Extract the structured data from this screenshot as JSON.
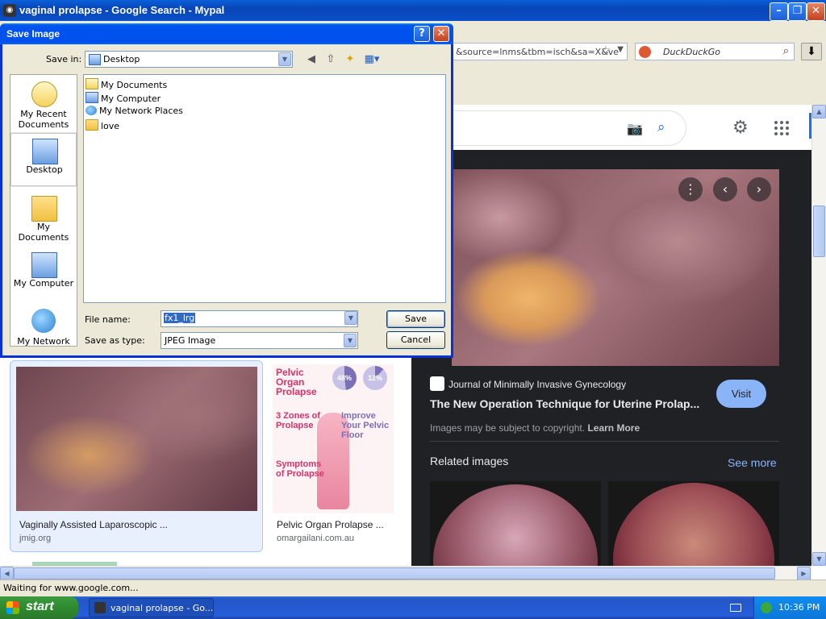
{
  "browser": {
    "title": "vaginal prolapse - Google Search - Mypal",
    "url": "&source=lnms&tbm=isch&sa=X&ve",
    "search_engine": "DuckDuckGo",
    "status": "Waiting for www.google.com..."
  },
  "dialog": {
    "title": "Save Image",
    "help": "?",
    "close": "✕",
    "save_in_label": "Save in:",
    "save_in_value": "Desktop",
    "places": [
      "My Recent Documents",
      "Desktop",
      "My Documents",
      "My Computer",
      "My Network"
    ],
    "files": [
      "My Documents",
      "My Computer",
      "My Network Places",
      "love"
    ],
    "file_name_label": "File name:",
    "file_name_value": "fx1_lrg",
    "save_as_type_label": "Save as type:",
    "save_as_type_value": "JPEG Image",
    "save_button": "Save",
    "cancel_button": "Cancel"
  },
  "preview": {
    "source": "Journal of Minimally Invasive Gynecology",
    "title": "The New Operation Technique for Uterine Prolap...",
    "visit": "Visit",
    "copyright": "Images may be subject to copyright.",
    "learn_more": "Learn More",
    "related": "Related images",
    "see_more": "See more"
  },
  "results": [
    {
      "title": "Vaginally Assisted Laparoscopic ...",
      "source": "jmig.org"
    },
    {
      "title": "Pelvic Organ Prolapse ...",
      "source": "omargailani.com.au"
    }
  ],
  "infographic": {
    "title": "Pelvic Organ Prolapse",
    "pct1": "48%",
    "pct2": "12%",
    "zones": "3 Zones of Prolapse",
    "improve": "Improve Your Pelvic Floor",
    "symptoms": "Symptoms of Prolapse"
  },
  "taskbar": {
    "start": "start",
    "task": "vaginal prolapse - Go...",
    "clock": "10:36 PM"
  }
}
